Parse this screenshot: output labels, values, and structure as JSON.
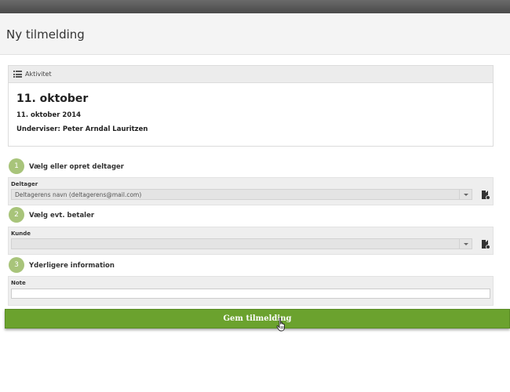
{
  "page": {
    "title": "Ny tilmelding"
  },
  "activity": {
    "header_label": "Aktivitet",
    "title": "11. oktober",
    "date": "11. oktober 2014",
    "teacher": "Underviser: Peter Arndal Lauritzen"
  },
  "steps": [
    {
      "number": "1",
      "label": "Vælg eller opret deltager",
      "field_label": "Deltager",
      "value": "Deltagerens navn (deltagerens@mail.com)"
    },
    {
      "number": "2",
      "label": "Vælg evt. betaler",
      "field_label": "Kunde",
      "value": ""
    },
    {
      "number": "3",
      "label": "Yderligere information",
      "field_label": "Note",
      "value": ""
    }
  ],
  "actions": {
    "save_label": "Gem tilmelding"
  },
  "icons": {
    "activity": "list-icon",
    "participant_action": "document-gear-icon",
    "payer_action": "document-gear-icon",
    "pointer": "hand-cursor-icon"
  },
  "colors": {
    "accent": "#6ba22e",
    "step_circle": "#a8c47a",
    "topbar": "#5a5a5a"
  }
}
